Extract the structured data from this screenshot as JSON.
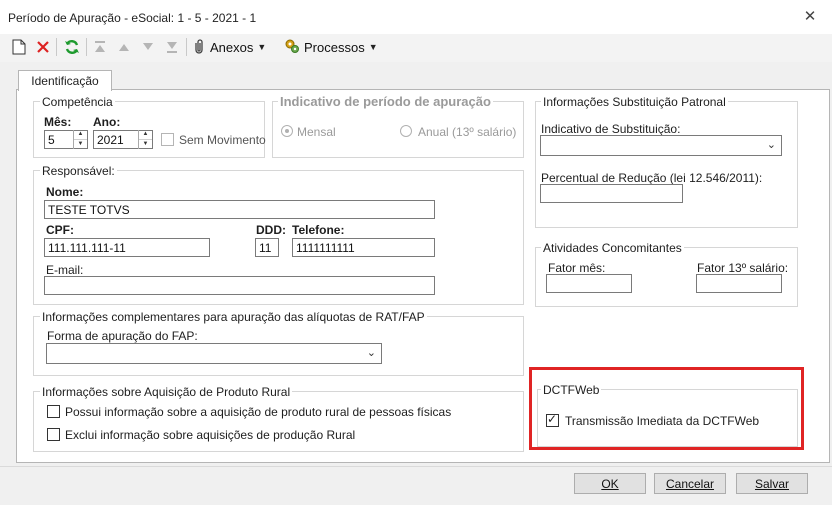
{
  "window": {
    "title": "Período de Apuração - eSocial: 1 - 5 - 2021 - 1"
  },
  "toolbar": {
    "anexos_label": "Anexos",
    "processos_label": "Processos"
  },
  "tabs": [
    {
      "label": "Identificação"
    }
  ],
  "competencia": {
    "group_label": "Competência",
    "mes_label": "Mês:",
    "mes_value": "5",
    "ano_label": "Ano:",
    "ano_value": "2021",
    "sem_movimento_label": "Sem Movimento"
  },
  "indicativo": {
    "group_label": "Indicativo de período de apuração",
    "mensal_label": "Mensal",
    "anual_label": "Anual (13º salário)"
  },
  "responsavel": {
    "group_label": "Responsável:",
    "nome_label": "Nome:",
    "nome_value": "TESTE TOTVS",
    "cpf_label": "CPF:",
    "cpf_value": "111.111.111-11",
    "ddd_label": "DDD:",
    "ddd_value": "11",
    "telefone_label": "Telefone:",
    "telefone_value": "1111111111",
    "email_label": "E-mail:",
    "email_value": ""
  },
  "rat_fap": {
    "group_label": "Informações complementares para apuração das alíquotas de RAT/FAP",
    "forma_label": "Forma de apuração do FAP:",
    "forma_value": ""
  },
  "produto_rural": {
    "group_label": "Informações sobre Aquisição de Produto Rural",
    "opt1_label": "Possui informação sobre a aquisição de produto rural de pessoas físicas",
    "opt2_label": "Exclui informação sobre aquisições de produção Rural"
  },
  "substituicao": {
    "group_label": "Informações Substituição Patronal",
    "indicativo_label": "Indicativo de Substituição:",
    "indicativo_value": "",
    "percentual_label": "Percentual de Redução  (lei 12.546/2011):",
    "percentual_value": ""
  },
  "atividades": {
    "group_label": "Atividades Concomitantes",
    "fator_mes_label": "Fator mês:",
    "fator_mes_value": "",
    "fator_13_label": "Fator 13º salário:",
    "fator_13_value": ""
  },
  "dctfweb": {
    "group_label": "DCTFWeb",
    "transmissao_label": "Transmissão Imediata da DCTFWeb",
    "transmissao_checked": true
  },
  "buttons": {
    "ok": "OK",
    "cancelar": "Cancelar",
    "salvar": "Salvar"
  },
  "colors": {
    "highlight": "#e02424",
    "toolbar_delete": "#d22",
    "toolbar_refresh": "#1e9a2e"
  }
}
